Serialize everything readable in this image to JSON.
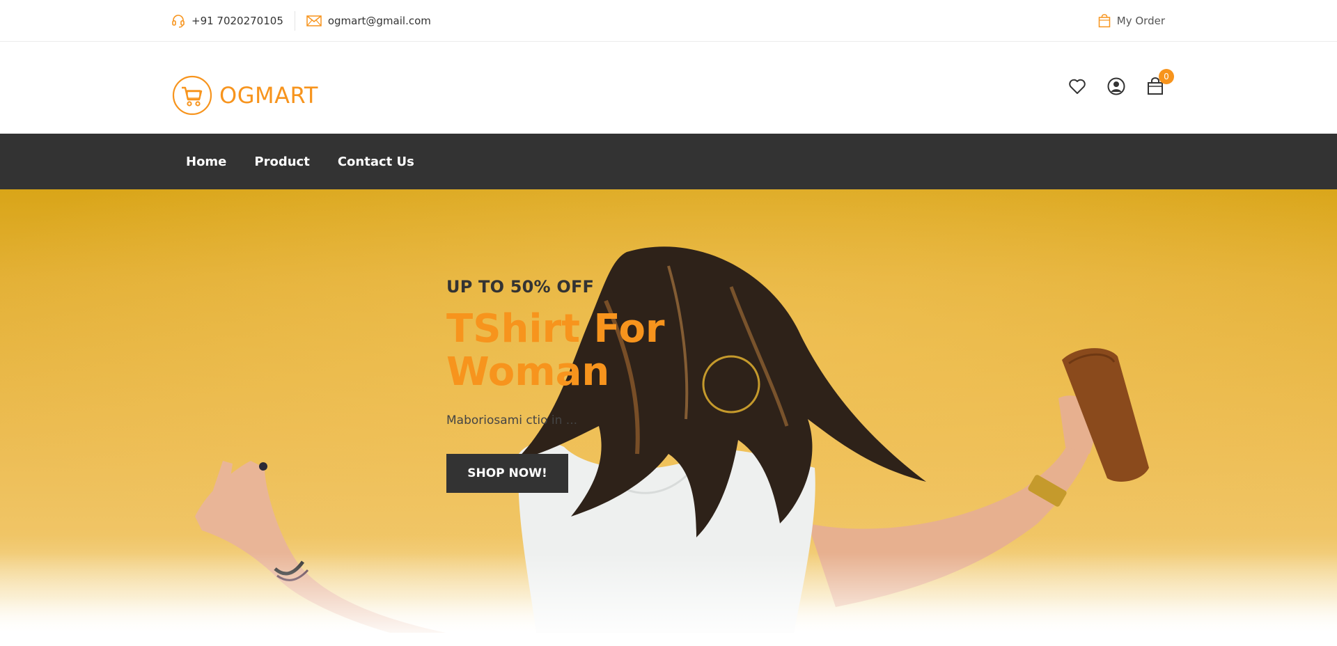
{
  "topbar": {
    "phone": "+91 7020270105",
    "phone_icon": "headset-icon",
    "email": "ogmart@gmail.com",
    "email_icon": "envelope-icon",
    "my_order": "My Order",
    "my_order_icon": "bag-icon"
  },
  "header": {
    "logo_text": "OGMART",
    "logo_icon": "cart-circle-icon",
    "icons": [
      "heart-icon",
      "user-icon",
      "cart-icon"
    ],
    "cart_count": "0"
  },
  "nav": {
    "items": [
      {
        "label": "Home"
      },
      {
        "label": "Product"
      },
      {
        "label": "Contact Us"
      }
    ]
  },
  "hero": {
    "subtitle": "UP TO 50% OFF",
    "title": "TShirt For Woman",
    "description": "Maboriosami ctio in ... ",
    "button": "SHOP NOW!"
  },
  "colors": {
    "accent": "#f7941d",
    "dark": "#333333",
    "hero_bg": "#e8b740"
  }
}
